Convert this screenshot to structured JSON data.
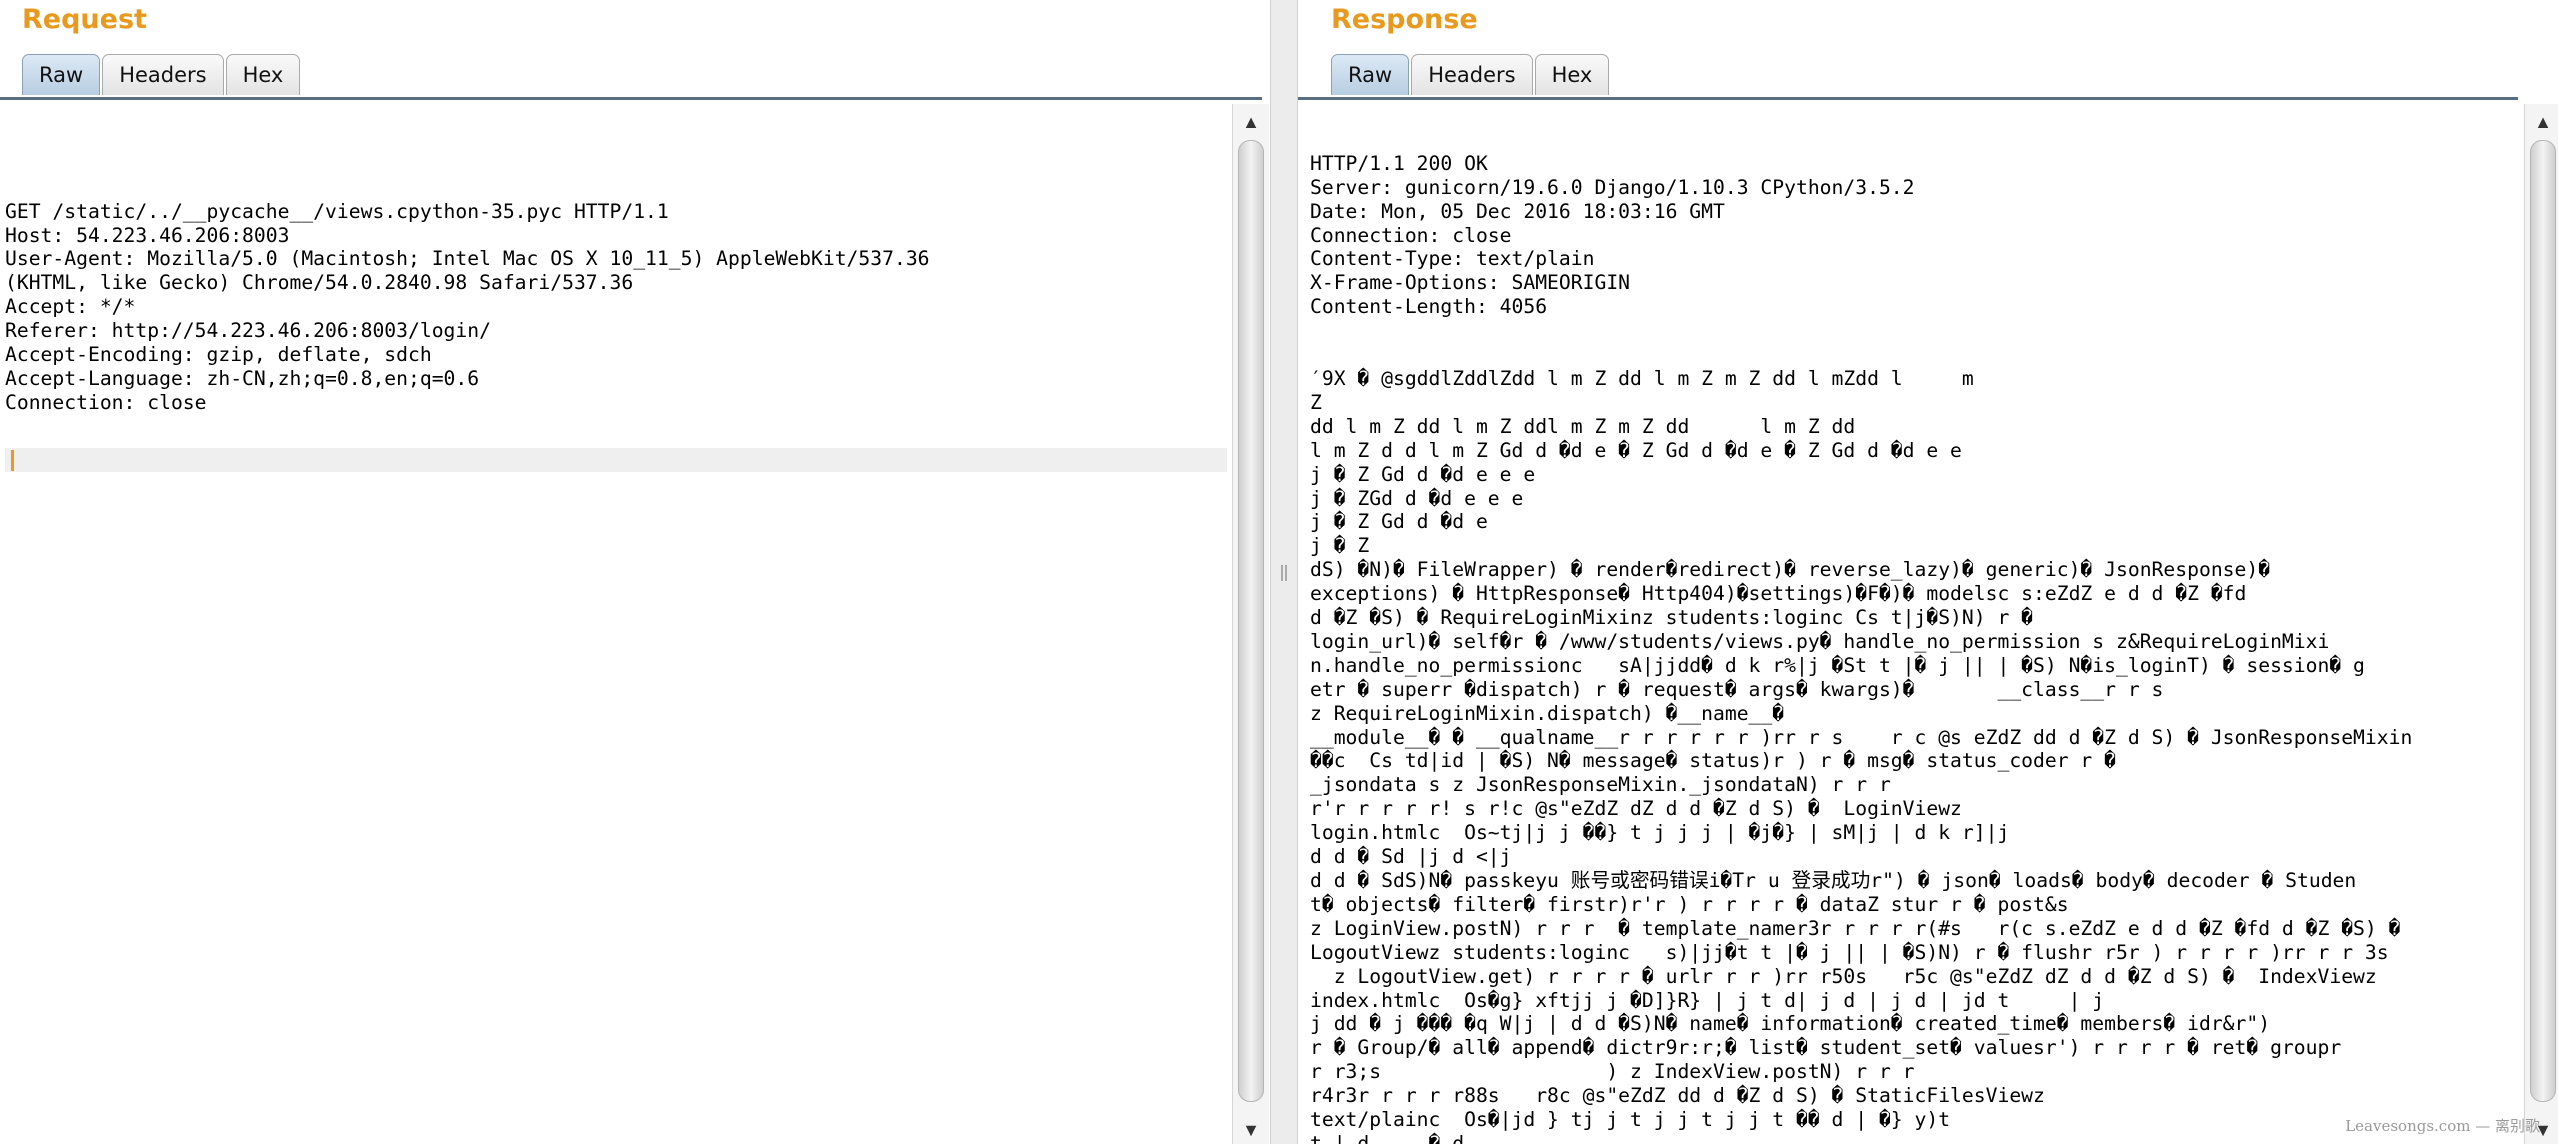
{
  "request": {
    "title": "Request",
    "tabs": [
      {
        "label": "Raw",
        "active": true
      },
      {
        "label": "Headers",
        "active": false
      },
      {
        "label": "Hex",
        "active": false
      }
    ],
    "body": "GET /static/../__pycache__/views.cpython-35.pyc HTTP/1.1\nHost: 54.223.46.206:8003\nUser-Agent: Mozilla/5.0 (Macintosh; Intel Mac OS X 10_11_5) AppleWebKit/537.36\n(KHTML, like Gecko) Chrome/54.0.2840.98 Safari/537.36\nAccept: */*\nReferer: http://54.223.46.206:8003/login/\nAccept-Encoding: gzip, deflate, sdch\nAccept-Language: zh-CN,zh;q=0.8,en;q=0.6\nConnection: close"
  },
  "response": {
    "title": "Response",
    "tabs": [
      {
        "label": "Raw",
        "active": true
      },
      {
        "label": "Headers",
        "active": false
      },
      {
        "label": "Hex",
        "active": false
      }
    ],
    "body": "HTTP/1.1 200 OK\nServer: gunicorn/19.6.0 Django/1.10.3 CPython/3.5.2\nDate: Mon, 05 Dec 2016 18:03:16 GMT\nConnection: close\nContent-Type: text/plain\nX-Frame-Options: SAMEORIGIN\nContent-Length: 4056\n\n\n′9X � @sgddlZddlZdd l m Z dd l m Z m Z dd l mZdd l     m\nZ\ndd l m Z dd l m Z ddl m Z m Z dd      l m Z dd\nl m Z d d l m Z Gd d �d e � Z Gd d �d e � Z Gd d �d e e\nj � Z Gd d �d e e e\nj � ZGd d �d e e e\nj � Z Gd d �d e\nj � Z\ndS) �N)� FileWrapper) � render�redirect)� reverse_lazy)� generic)� JsonResponse)�\nexceptions) � HttpResponse� Http404)�settings)�F�)� modelsc s:eZdZ e d d �Z �fd\nd �Z �S) � RequireLoginMixinz students:loginc Cs t|j�S)N) r �\nlogin_url)� self�r � /www/students/views.py� handle_no_permission s z&RequireLoginMixi\nn.handle_no_permissionc   sA|jjdd� d k r%|j �St t |� j || | �S) N�is_loginT) � session� g\netr � superr �dispatch) r � request� args� kwargs)�       __class__r r s\nz RequireLoginMixin.dispatch) �__name__�\n__module__� � __qualname__r r r r r r )rr r s    r c @s eZdZ dd d �Z d S) � JsonResponseMixin\n��c  Cs td|id | �S) N� message� status)r ) r � msg� status_coder r �\n_jsondata s z JsonResponseMixin._jsondataN) r r r\nr'r r r r r! s r!c @s\"eZdZ dZ d d �Z d S) �  LoginViewz\nlogin.htmlc  Os~tj|j j ��} t j j j | �j�} | sM|j | d k r]|j\nd d � Sd |j d <|j\nd d � SdS)N� passkeyu 账号或密码错误i�Tr u 登录成功r\") � json� loads� body� decoder � Studen\nt� objects� filter� firstr)r'r ) r r r r � dataZ stur r � post&s\nz LoginView.postN) r r r  � template_namer3r r r r r(#s   r(c s.eZdZ e d d �Z �fd d �Z �S) �\nLogoutViewz students:loginc   s)|jj�t t |� j || | �S)N) r � flushr r5r ) r r r r )rr r r 3s\n  z LogoutView.get) r r r r � urlr r r )rr r50s   r5c @s\"eZdZ dZ d d �Z d S) �  IndexViewz\nindex.htmlc  Os�g} xftjj j �D]}R} | j t d| j d | j d | jd t     | j\nj dd � j ��� �q W|j | d d �S)N� name� information� created_time� members� idr&r\")\nr � Group/� all� append� dictr9r:r;� list� student_set� valuesr') r r r r � ret� groupr\nr r3;s                   ) z IndexView.postN) r r r\nr4r3r r r r r88s   r8c @s\"eZdZ dd d �Z d S) � StaticFilesViewz\ntext/plainc  Os�|jd } tj j t j j t j j t �� d | �} y)t\nt | d     � d\n� d |j �SWnl t k\n"
  },
  "watermark": "Leavesongs.com — 离别歌"
}
